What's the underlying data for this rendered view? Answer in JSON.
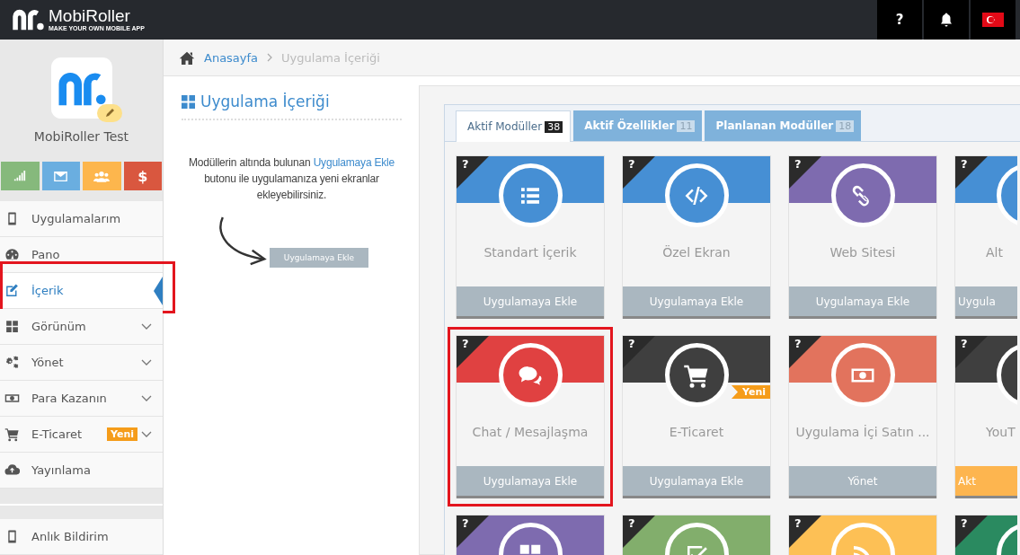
{
  "header": {
    "logo": {
      "name": "MobiRoller",
      "tagline": "MAKE YOUR OWN MOBILE APP"
    },
    "help": "?"
  },
  "sidebar": {
    "app_name": "MobiRoller Test",
    "quick_buttons": [
      {
        "color": "#86b97c"
      },
      {
        "color": "#6aaee0"
      },
      {
        "color": "#fdb64d"
      },
      {
        "color": "#d9573f",
        "label": "$"
      }
    ],
    "items": [
      {
        "label": "Uygulamalarım",
        "selected": false,
        "expandable": false,
        "highlighted": false
      },
      {
        "label": "Pano",
        "selected": false,
        "expandable": false,
        "highlighted": false
      },
      {
        "label": "İçerik",
        "selected": true,
        "expandable": false,
        "highlighted": true
      },
      {
        "label": "Görünüm",
        "selected": false,
        "expandable": true,
        "highlighted": false
      },
      {
        "label": "Yönet",
        "selected": false,
        "expandable": true,
        "highlighted": false
      },
      {
        "label": "Para Kazanın",
        "selected": false,
        "expandable": true,
        "highlighted": false
      },
      {
        "label": "E-Ticaret",
        "selected": false,
        "expandable": true,
        "highlighted": false,
        "badge": "Yeni"
      },
      {
        "label": "Yayınlama",
        "selected": false,
        "expandable": false,
        "highlighted": false
      }
    ],
    "bottom_items": [
      {
        "label": "Anlık Bildirim",
        "selected": false,
        "expandable": false,
        "highlighted": false
      }
    ]
  },
  "breadcrumb": [
    {
      "label": "Anasayfa",
      "link": true
    },
    {
      "label": "Uygulama İçeriği",
      "link": false
    }
  ],
  "content_panel": {
    "title": "Uygulama İçeriği",
    "hint": {
      "before": "Modüllerin altında bulunan",
      "link": "Uygulamaya Ekle",
      "after": "butonu ile uygulamanıza yeni ekranlar ekleyebilirsiniz."
    },
    "button": "Uygulamaya Ekle"
  },
  "modules": {
    "tabs": [
      {
        "label": "Aktif Modüller",
        "count": "38",
        "selected": true
      },
      {
        "label": "Aktif Özellikler",
        "count": "11",
        "selected": false
      },
      {
        "label": "Planlanan Modüller",
        "count": "18",
        "selected": false
      }
    ],
    "cards": [
      {
        "help": "?",
        "title": "Standart İçerik",
        "color": "#468fd4",
        "button": "Uygulamaya Ekle",
        "accent": false,
        "highlighted": false
      },
      {
        "help": "?",
        "title": "Özel Ekran",
        "color": "#468fd4",
        "button": "Uygulamaya Ekle",
        "accent": false,
        "highlighted": false
      },
      {
        "help": "?",
        "title": "Web Sitesi",
        "color": "#7e6baf",
        "button": "Uygulamaya Ekle",
        "accent": false,
        "highlighted": false
      },
      {
        "help": "?",
        "title": "Alt",
        "color": "#468fd4",
        "button": "Uygula",
        "accent": false,
        "highlighted": false
      },
      {
        "help": "?",
        "title": "Chat / Mesajlaşma",
        "color": "#e04141",
        "button": "Uygulamaya Ekle",
        "accent": false,
        "highlighted": true
      },
      {
        "help": "?",
        "title": "E-Ticaret",
        "color": "#3f3f3f",
        "button": "Uygulamaya Ekle",
        "accent": false,
        "highlighted": false,
        "badge": "Yeni"
      },
      {
        "help": "?",
        "title": "Uygulama İçi Satın ...",
        "color": "#e2735d",
        "button": "Yönet",
        "accent": false,
        "highlighted": false
      },
      {
        "help": "?",
        "title": "YouT",
        "color": "#3f3f3f",
        "button": "Akt",
        "accent": true,
        "highlighted": false
      },
      {
        "help": "?",
        "color": "#7e6baf",
        "highlighted": false
      },
      {
        "help": "?",
        "color": "#82ae6c",
        "highlighted": false
      },
      {
        "help": "?",
        "color": "#fdc055",
        "highlighted": false
      },
      {
        "help": "?",
        "color": "#2a8a60",
        "highlighted": false
      }
    ]
  }
}
